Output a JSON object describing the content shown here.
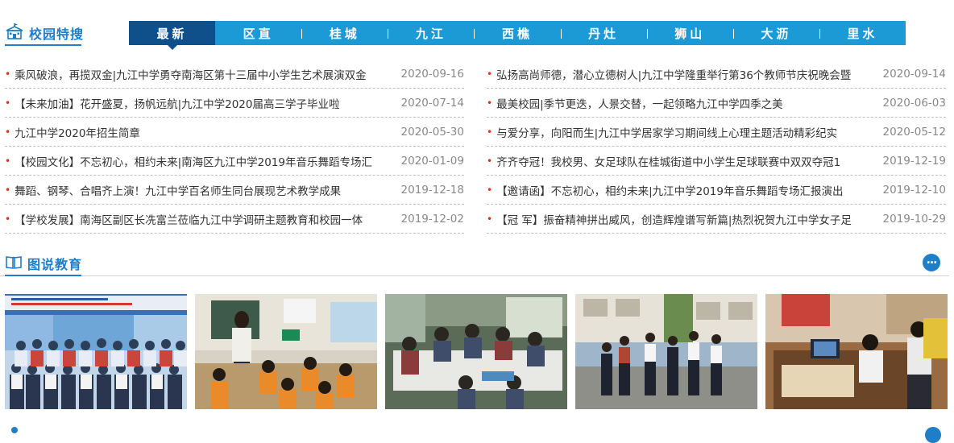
{
  "section1": {
    "title": "校园特搜",
    "tabs": [
      "最新",
      "区直",
      "桂城",
      "九江",
      "西樵",
      "丹灶",
      "狮山",
      "大沥",
      "里水"
    ],
    "active_tab": "最新"
  },
  "news_left": [
    {
      "title": "乘风破浪，再揽双金|九江中学勇夺南海区第十三届中小学生艺术展演双金",
      "date": "2020-09-16"
    },
    {
      "title": "【未来加油】花开盛夏，扬帆远航|九江中学2020届高三学子毕业啦",
      "date": "2020-07-14"
    },
    {
      "title": "九江中学2020年招生简章",
      "date": "2020-05-30"
    },
    {
      "title": "【校园文化】不忘初心，相约未来|南海区九江中学2019年音乐舞蹈专场汇",
      "date": "2020-01-09"
    },
    {
      "title": "舞蹈、钢琴、合唱齐上演！九江中学百名师生同台展现艺术教学成果",
      "date": "2019-12-18"
    },
    {
      "title": "【学校发展】南海区副区长冼富兰莅临九江中学调研主题教育和校园一体",
      "date": "2019-12-02"
    }
  ],
  "news_right": [
    {
      "title": "弘扬高尚师德，潜心立德树人|九江中学隆重举行第36个教师节庆祝晚会暨",
      "date": "2020-09-14"
    },
    {
      "title": "最美校园|季节更迭，人景交替，一起领略九江中学四季之美",
      "date": "2020-06-03"
    },
    {
      "title": "与爱分享，向阳而生|九江中学居家学习期间线上心理主题活动精彩纪实",
      "date": "2020-05-12"
    },
    {
      "title": "齐齐夺冠！我校男、女足球队在桂城街道中小学生足球联赛中双双夺冠1",
      "date": "2019-12-19"
    },
    {
      "title": "【邀请函】不忘初心，相约未来|九江中学2019年音乐舞蹈专场汇报演出",
      "date": "2019-12-10"
    },
    {
      "title": "【冠 军】振奋精神拼出威风，创造辉煌谱写新篇|热烈祝贺九江中学女子足",
      "date": "2019-10-29"
    }
  ],
  "section2": {
    "title": "图说教育",
    "more_icon": "more-dots-icon"
  },
  "photos": [
    {
      "icon": "group-photo-students"
    },
    {
      "icon": "classroom-teacher-photo"
    },
    {
      "icon": "meeting-room-photo"
    },
    {
      "icon": "campus-visit-photo"
    },
    {
      "icon": "home-study-photo"
    }
  ],
  "colors": {
    "accent": "#1e7ec8",
    "tab_bar": "#1b9ad6",
    "tab_active": "#0f4f8a",
    "bullet": "#e0301e"
  }
}
